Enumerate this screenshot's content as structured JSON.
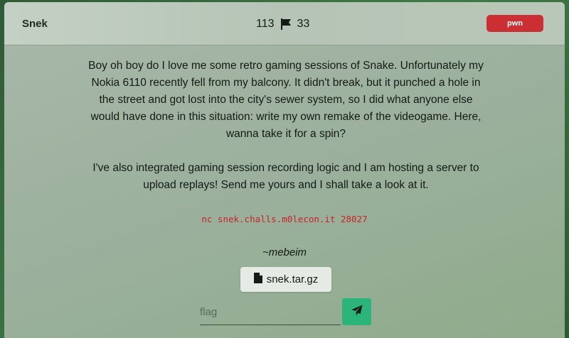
{
  "challenge": {
    "title": "Snek",
    "solves": "113",
    "points": "33",
    "tag": "pwn",
    "description": [
      "Boy oh boy do I love me some retro gaming sessions of Snake. Unfortunately my Nokia 6110 recently fell from my balcony. It didn't break, but it punched a hole in the street and got lost into the city's sewer system, so I did what anyone else would have done in this situation: write my own remake of the videogame. Here, wanna take it for a spin?",
      "I've also integrated gaming session recording logic and I am hosting a server to upload replays! Send me yours and I shall take a look at it."
    ],
    "command": "nc snek.challs.m0lecon.it 28027",
    "author": "~mebeim",
    "file_label": "snek.tar.gz",
    "flag_placeholder": "flag"
  },
  "colors": {
    "tag": "#cc2f33",
    "submit": "#2cb57a",
    "command": "#c8232a"
  },
  "icons": {
    "stats": "flag-icon",
    "file": "file-icon",
    "submit": "paper-plane-icon"
  }
}
